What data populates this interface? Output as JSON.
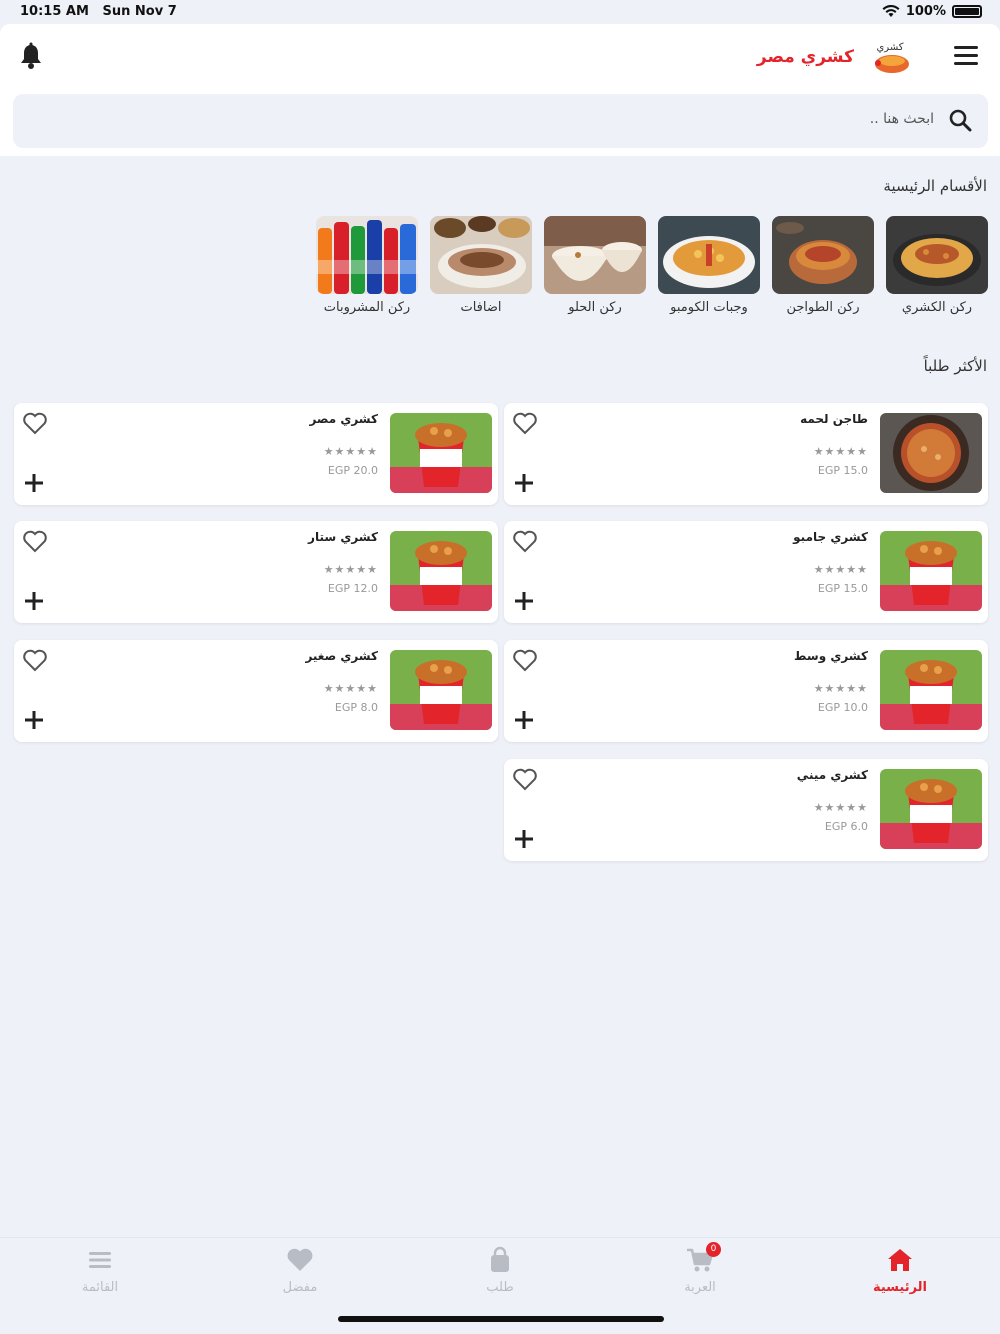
{
  "status": {
    "time": "10:15 AM",
    "date": "Sun Nov 7",
    "battery": "100%"
  },
  "header": {
    "brand_name": "كشري مصر",
    "logo_text": "كشري"
  },
  "search": {
    "placeholder": "ابحث هنا .."
  },
  "sections": {
    "categories_title": "الأقسام الرئيسية",
    "popular_title": "الأكثر طلباً"
  },
  "categories": [
    {
      "label": "ركن الكشري",
      "image": "koshary-plate"
    },
    {
      "label": "ركن الطواجن",
      "image": "tagine"
    },
    {
      "label": "وجبات الكومبو",
      "image": "combo-meal"
    },
    {
      "label": "ركن الحلو",
      "image": "dessert-cups"
    },
    {
      "label": "اضافات",
      "image": "sides"
    },
    {
      "label": "ركن المشروبات",
      "image": "soft-drinks"
    }
  ],
  "products": [
    {
      "name": "طاجن لحمه",
      "rating": "★★★★★",
      "price": "EGP 15.0",
      "image": "meat-tagine"
    },
    {
      "name": "كشري مصر",
      "rating": "★★★★★",
      "price": "EGP 20.0",
      "image": "koshary-bucket"
    },
    {
      "name": "كشري جامبو",
      "rating": "★★★★★",
      "price": "EGP 15.0",
      "image": "koshary-bucket"
    },
    {
      "name": "كشري ستار",
      "rating": "★★★★★",
      "price": "EGP 12.0",
      "image": "koshary-bucket"
    },
    {
      "name": "كشري وسط",
      "rating": "★★★★★",
      "price": "EGP 10.0",
      "image": "koshary-bucket"
    },
    {
      "name": "كشري صغير",
      "rating": "★★★★★",
      "price": "EGP 8.0",
      "image": "koshary-bucket"
    },
    {
      "name": "كشري ميني",
      "rating": "★★★★★",
      "price": "EGP 6.0",
      "image": "koshary-bucket"
    }
  ],
  "tabs": [
    {
      "label": "الرئيسية",
      "icon": "home-icon",
      "active": true
    },
    {
      "label": "العربة",
      "icon": "cart-icon",
      "badge": "0"
    },
    {
      "label": "طلب",
      "icon": "bag-icon"
    },
    {
      "label": "مفضل",
      "icon": "heart-icon"
    },
    {
      "label": "القائمة",
      "icon": "list-icon"
    }
  ],
  "colors": {
    "accent": "#e3242b",
    "background": "#eef2f8",
    "inactive": "#b8bcc4"
  }
}
